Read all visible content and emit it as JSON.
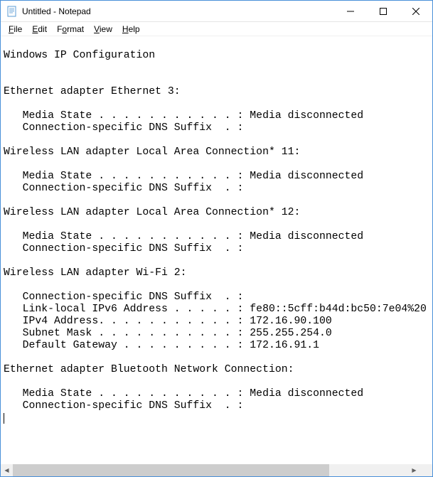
{
  "window": {
    "title": "Untitled - Notepad"
  },
  "menubar": {
    "file": "File",
    "edit": "Edit",
    "format": "Format",
    "view": "View",
    "help": "Help"
  },
  "editor": {
    "content": "\nWindows IP Configuration\n\n\nEthernet adapter Ethernet 3:\n\n   Media State . . . . . . . . . . . : Media disconnected\n   Connection-specific DNS Suffix  . :\n\nWireless LAN adapter Local Area Connection* 11:\n\n   Media State . . . . . . . . . . . : Media disconnected\n   Connection-specific DNS Suffix  . :\n\nWireless LAN adapter Local Area Connection* 12:\n\n   Media State . . . . . . . . . . . : Media disconnected\n   Connection-specific DNS Suffix  . :\n\nWireless LAN adapter Wi-Fi 2:\n\n   Connection-specific DNS Suffix  . :\n   Link-local IPv6 Address . . . . . : fe80::5cff:b44d:bc50:7e04%20\n   IPv4 Address. . . . . . . . . . . : 172.16.90.100\n   Subnet Mask . . . . . . . . . . . : 255.255.254.0\n   Default Gateway . . . . . . . . . : 172.16.91.1\n\nEthernet adapter Bluetooth Network Connection:\n\n   Media State . . . . . . . . . . . : Media disconnected\n   Connection-specific DNS Suffix  . :"
  }
}
